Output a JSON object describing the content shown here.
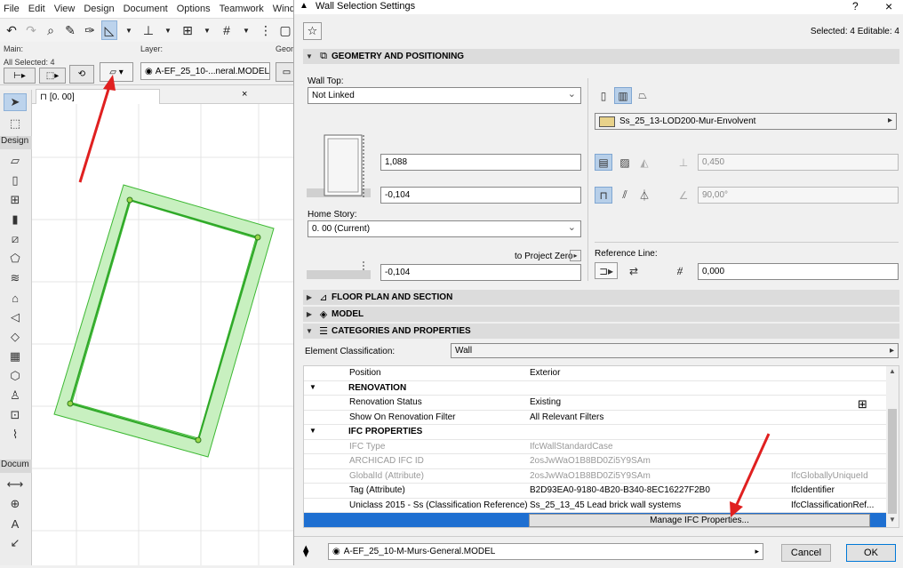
{
  "app": {
    "menu": [
      "File",
      "Edit",
      "View",
      "Design",
      "Document",
      "Options",
      "Teamwork",
      "Window"
    ],
    "info_main": "Main:",
    "info_all_selected": "All Selected: 4",
    "info_layer_label": "Layer:",
    "info_layer_value": "A-EF_25_10-...neral.MODEL",
    "info_geom": "Geom",
    "toolbox_design": "Design",
    "toolbox_docum": "Docum",
    "tab_label": "[0. 00]",
    "tab_close": "×"
  },
  "dialog": {
    "title": "Wall Selection Settings",
    "help": "?",
    "close": "×",
    "selected_text": "Selected: 4 Editable: 4",
    "sections": {
      "geometry": "GEOMETRY AND POSITIONING",
      "floorplan": "FLOOR PLAN AND SECTION",
      "model": "MODEL",
      "categories": "CATEGORIES AND PROPERTIES"
    },
    "geometry": {
      "wall_top_label": "Wall Top:",
      "wall_top_value": "Not Linked",
      "height_value": "1,088",
      "offset_top_value": "-0,104",
      "home_story_label": "Home Story:",
      "home_story_value": "0. 00 (Current)",
      "to_project_zero": "to Project Zero",
      "base_offset_value": "-0,104",
      "composite_value": "Ss_25_13-LOD200-Mur-Envolvent",
      "thickness_value": "0,450",
      "angle_value": "90,00°",
      "reference_line_label": "Reference Line:",
      "ref_offset_value": "0,000"
    },
    "categories": {
      "element_class_label": "Element Classification:",
      "element_class_value": "Wall"
    },
    "properties": [
      {
        "type": "row",
        "name": "Position",
        "value": "Exterior",
        "extra": ""
      },
      {
        "type": "group",
        "name": "RENOVATION"
      },
      {
        "type": "row",
        "name": "Renovation Status",
        "value": "Existing",
        "extra": ""
      },
      {
        "type": "row",
        "name": "Show On Renovation Filter",
        "value": "All Relevant Filters",
        "extra": ""
      },
      {
        "type": "group",
        "name": "IFC PROPERTIES"
      },
      {
        "type": "dim",
        "name": "IFC Type",
        "value": "IfcWallStandardCase",
        "extra": ""
      },
      {
        "type": "dim",
        "name": "ARCHICAD IFC ID",
        "value": "2osJwWaO1B8BD0Zi5Y9SAm",
        "extra": ""
      },
      {
        "type": "dim",
        "name": "GlobalId (Attribute)",
        "value": "2osJwWaO1B8BD0Zi5Y9SAm",
        "extra": "IfcGloballyUniqueId"
      },
      {
        "type": "row",
        "name": "Tag (Attribute)",
        "value": "B2D93EA0-9180-4B20-B340-8EC16227F2B0",
        "extra": "IfcIdentifier"
      },
      {
        "type": "row",
        "name": "Uniclass 2015 - Ss (Classification Reference)",
        "value": "Ss_25_13_45 Lead brick wall systems",
        "extra": "IfcClassificationRef..."
      }
    ],
    "manage_ifc_label": "Manage IFC Properties...",
    "footer_layer": "A-EF_25_10-M-Murs-General.MODEL",
    "cancel_label": "Cancel",
    "ok_label": "OK"
  },
  "colors": {
    "wall_fill": "#c8f0c0",
    "wall_stroke": "#3cb832",
    "annotation_arrow": "#e02020",
    "selection_blue": "#1e6fd1"
  }
}
